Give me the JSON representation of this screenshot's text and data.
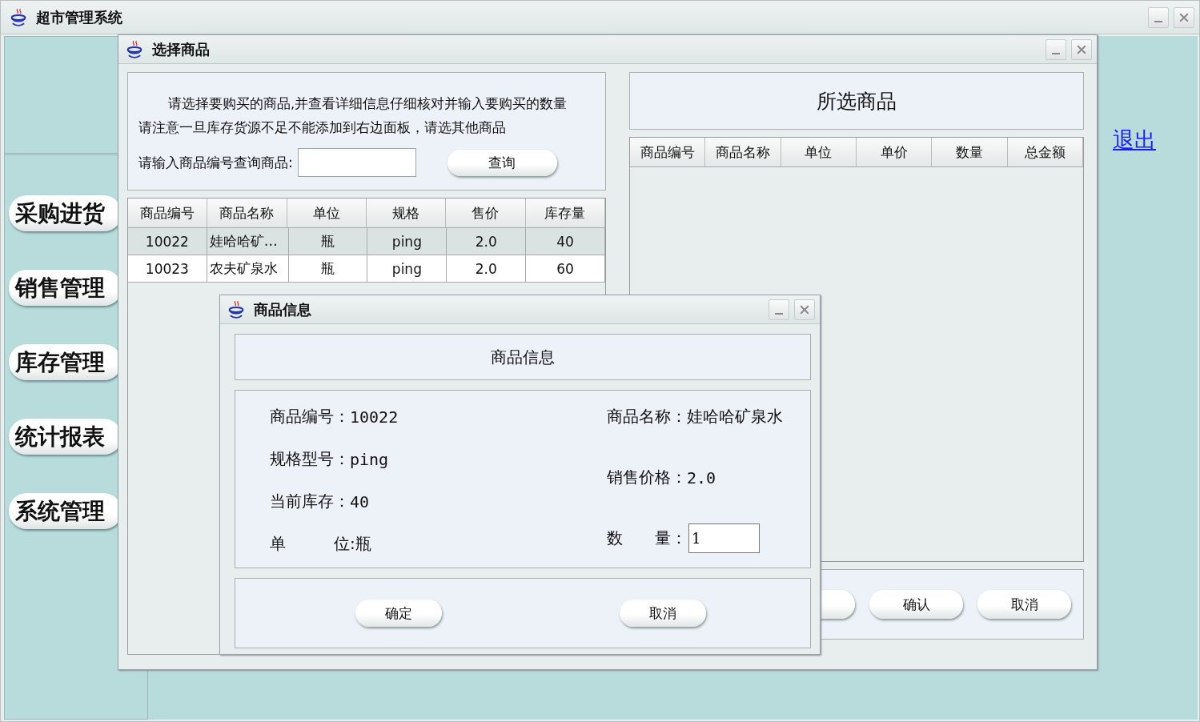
{
  "main_window": {
    "title": "超市管理系统",
    "exit_link": "退出",
    "nav_buttons": [
      "采购进货",
      "销售管理",
      "库存管理",
      "统计报表",
      "系统管理"
    ]
  },
  "select_window": {
    "title": "选择商品",
    "instructions": [
      "请选择要购买的商品,并查看详细信息仔细核对并输入要购买的数量",
      "请注意一旦库存货源不足不能添加到右边面板，请选其他商品"
    ],
    "search": {
      "label": "请输入商品编号查询商品:",
      "button": "查询"
    },
    "products_table": {
      "columns": [
        "商品编号",
        "商品名称",
        "单位",
        "规格",
        "售价",
        "库存量"
      ],
      "rows": [
        {
          "cells": [
            "10022",
            "娃哈哈矿…",
            "瓶",
            "ping",
            "2.0",
            "40"
          ],
          "selected": true
        },
        {
          "cells": [
            "10023",
            "农夫矿泉水",
            "瓶",
            "ping",
            "2.0",
            "60"
          ],
          "selected": false
        }
      ]
    },
    "selected_panel": {
      "title": "所选商品",
      "columns": [
        "商品编号",
        "商品名称",
        "单位",
        "单价",
        "数量",
        "总金额"
      ]
    },
    "buttons": [
      "确认",
      "取消"
    ]
  },
  "info_dialog": {
    "title": "商品信息",
    "heading": "商品信息",
    "fields_left": [
      {
        "label": "商品编号：",
        "value": "10022"
      },
      {
        "label": "规格型号：",
        "value": "ping"
      },
      {
        "label": "当前库存：",
        "value": "40"
      },
      {
        "label": "单　　　位:",
        "value": "瓶"
      }
    ],
    "fields_right": [
      {
        "label": "商品名称：",
        "value": "娃哈哈矿泉水"
      },
      {
        "label": "销售价格：",
        "value": "2.0"
      }
    ],
    "quantity": {
      "label": "数　　量：",
      "value": "1"
    },
    "buttons": [
      "确定",
      "取消"
    ]
  }
}
